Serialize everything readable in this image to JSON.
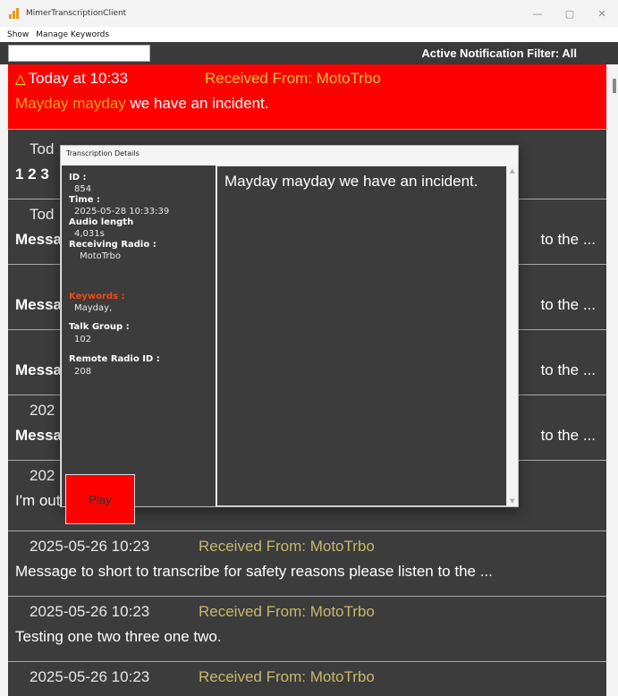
{
  "window": {
    "title": "MimerTranscriptionClient",
    "minimize": "—",
    "maximize": "▢",
    "close": "✕"
  },
  "menu": {
    "show": "Show",
    "manage_keywords": "Manage Keywords"
  },
  "filter": {
    "search_value": "",
    "active_filter": "Active Notification Filter: All"
  },
  "list": {
    "items": [
      {
        "time": "Today at 10:33",
        "from": "Received From: MotoTrbo",
        "keyword": "Mayday mayday",
        "message": " we have an incident.",
        "alert": true
      },
      {
        "time": "Tod",
        "from": "",
        "message": "1 2 3",
        "suffix": ""
      },
      {
        "time": "Tod",
        "from": "",
        "message": "Messa",
        "suffix": "to the ..."
      },
      {
        "time": "",
        "from": "",
        "message": "Messa",
        "suffix": "to the ..."
      },
      {
        "time": "",
        "from": "",
        "message": "Messa",
        "suffix": "to the ..."
      },
      {
        "time": "202",
        "from": "",
        "message": "Messa",
        "suffix": "to the ..."
      },
      {
        "time": "202",
        "from": "",
        "message": "I'm out.",
        "suffix": ""
      },
      {
        "time": "2025-05-26 10:23",
        "from": "Received From: MotoTrbo",
        "message": "Message to short to transcribe for safety reasons please listen to the ..."
      },
      {
        "time": "2025-05-26 10:23",
        "from": "Received From: MotoTrbo",
        "message": "Testing one two three one two."
      },
      {
        "time": "2025-05-26 10:23",
        "from": "Received From: MotoTrbo",
        "message": ""
      }
    ]
  },
  "dialog": {
    "title": "Transcription Details",
    "id_label": "ID :",
    "id_value": "854",
    "time_label": "Time :",
    "time_value": "2025-05-28 10:33:39",
    "audio_label": "Audio length",
    "audio_value": "4,031s",
    "radio_label": "Receiving Radio :",
    "radio_value": "MotoTrbo",
    "keywords_label": "Keywords :",
    "keywords_value": "Mayday,",
    "talkgroup_label": "Talk Group :",
    "talkgroup_value": "102",
    "remote_label": "Remote Radio ID :",
    "remote_value": "208",
    "play_label": "Play",
    "transcript": "Mayday mayday we have an incident.",
    "scroll_up": "▲",
    "scroll_down": "▼"
  },
  "colors": {
    "alert_red": "#fe0000",
    "keyword_orange": "#f0a020",
    "from_gold": "#c9b86b",
    "panel_dark": "#3c3c3c"
  }
}
